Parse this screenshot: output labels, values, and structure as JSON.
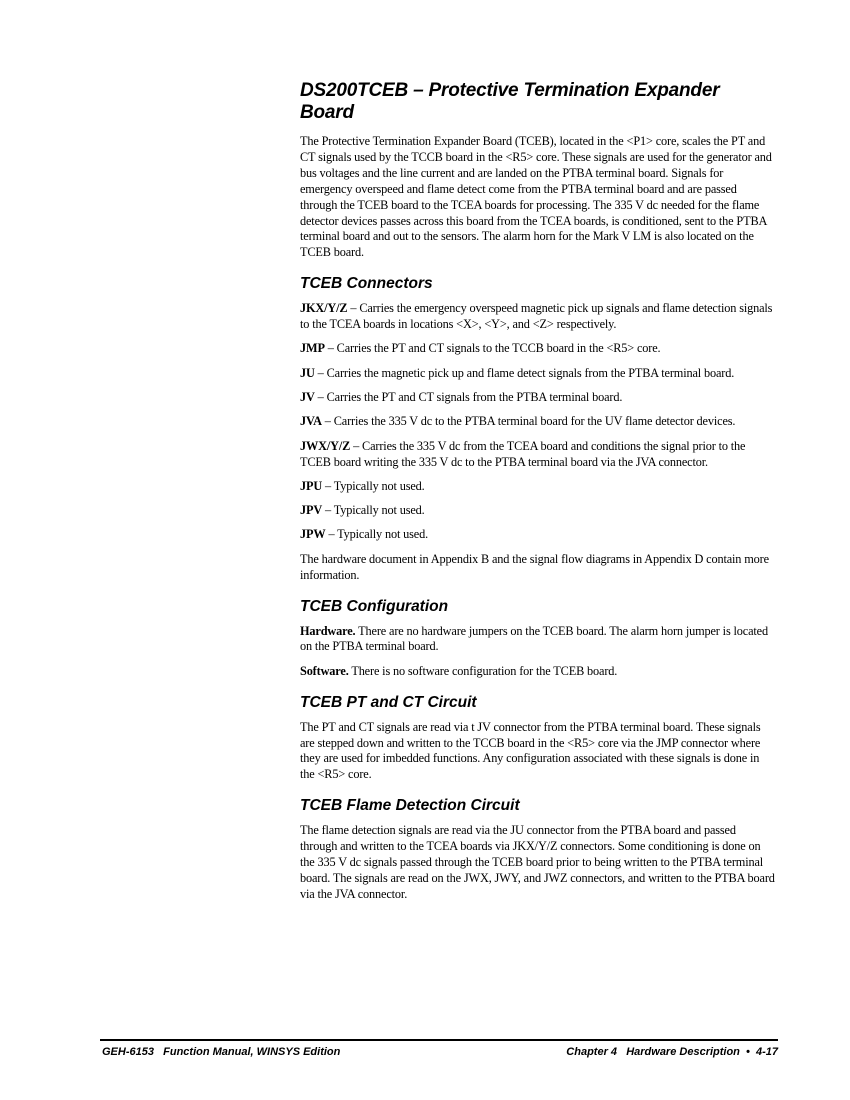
{
  "title": "DS200TCEB – Protective Termination Expander Board",
  "intro": "The Protective Termination Expander Board (TCEB), located in the <P1> core, scales the PT and CT signals used by the TCCB board in the <R5> core. These signals are used for the generator and bus voltages and the line current and are landed on the PTBA terminal board. Signals for emergency overspeed and flame detect come from the PTBA terminal board and are passed through the TCEB board to the TCEA boards for processing. The 335 V dc needed for the flame detector devices passes across this board from the TCEA boards, is conditioned, sent to the PTBA terminal board and out to the sensors. The alarm horn for the Mark V LM is also located on the TCEB board.",
  "connectors": {
    "heading": "TCEB Connectors",
    "items": [
      {
        "name": "JKX/Y/Z",
        "text": " – Carries the emergency overspeed  magnetic pick up signals and flame detection signals to the TCEA boards in locations <X>, <Y>, and <Z> respectively."
      },
      {
        "name": "JMP",
        "text": " – Carries the PT and CT signals to the TCCB board in the <R5> core."
      },
      {
        "name": "JU",
        "text": " – Carries the magnetic pick up and flame detect signals from the PTBA terminal board."
      },
      {
        "name": "JV",
        "text": " – Carries the PT and CT signals from the PTBA terminal board."
      },
      {
        "name": "JVA",
        "text": " – Carries the 335 V dc to the PTBA terminal board for the UV flame detector devices."
      },
      {
        "name": "JWX/Y/Z",
        "text": " – Carries the 335 V dc from the TCEA board and conditions the signal prior to the TCEB board writing the 335 V dc to the PTBA terminal board via the JVA connector."
      },
      {
        "name": "JPU",
        "text": " – Typically not used."
      },
      {
        "name": "JPV",
        "text": " – Typically not used."
      },
      {
        "name": "JPW",
        "text": " – Typically not used."
      }
    ],
    "note": "The hardware document in Appendix B and the signal flow diagrams in Appendix D contain more information."
  },
  "configuration": {
    "heading": "TCEB Configuration",
    "hardware_label": "Hardware.",
    "hardware_text": " There are no hardware jumpers on the TCEB board. The alarm horn jumper is located on the PTBA terminal board.",
    "software_label": "Software.",
    "software_text": " There is no software configuration for the TCEB board."
  },
  "pt_ct": {
    "heading": "TCEB PT and CT Circuit",
    "text": "The PT and CT signals are read via t JV connector from the PTBA terminal board. These signals are stepped down and written to the TCCB board in the <R5> core via the JMP connector where they are used for imbedded functions. Any configuration associated with these signals is done in the <R5> core."
  },
  "flame": {
    "heading": "TCEB Flame Detection Circuit",
    "text": "The flame detection signals are read via the JU connector from the PTBA board and passed through and written to the TCEA boards via JKX/Y/Z connectors. Some conditioning is done on the 335 V dc signals passed through the TCEB board prior to being written to the PTBA terminal board. The signals are read on the JWX, JWY, and JWZ connectors, and written to the PTBA board via the JVA connector."
  },
  "footer": {
    "left": "GEH-6153   Function Manual, WINSYS Edition",
    "right": "Chapter 4   Hardware Description  •  4-17"
  }
}
